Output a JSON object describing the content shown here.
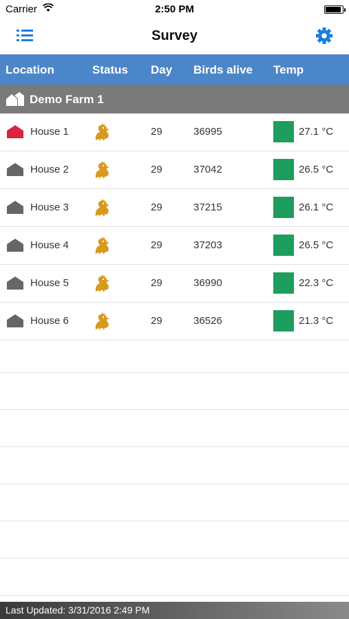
{
  "status_bar": {
    "carrier": "Carrier",
    "time": "2:50 PM",
    "battery_level": 0.9
  },
  "nav": {
    "title": "Survey",
    "menu_icon": "list-icon",
    "settings_icon": "gear-icon",
    "accent_color": "#1a7de0"
  },
  "columns": {
    "location": "Location",
    "status": "Status",
    "day": "Day",
    "birds_alive": "Birds alive",
    "temp": "Temp",
    "header_color": "#4b86c8"
  },
  "farm": {
    "name": "Demo Farm 1",
    "icon": "farm-icon"
  },
  "houses": [
    {
      "name": "House 1",
      "day": "29",
      "birds": "36995",
      "temp": "27.1 °C",
      "house_color": "#d7263d",
      "temp_color": "#1e9e5e",
      "status_icon": "chicken-icon"
    },
    {
      "name": "House 2",
      "day": "29",
      "birds": "37042",
      "temp": "26.5 °C",
      "house_color": "#666666",
      "temp_color": "#1e9e5e",
      "status_icon": "chicken-icon"
    },
    {
      "name": "House 3",
      "day": "29",
      "birds": "37215",
      "temp": "26.1 °C",
      "house_color": "#666666",
      "temp_color": "#1e9e5e",
      "status_icon": "chicken-icon"
    },
    {
      "name": "House 4",
      "day": "29",
      "birds": "37203",
      "temp": "26.5 °C",
      "house_color": "#666666",
      "temp_color": "#1e9e5e",
      "status_icon": "chicken-icon"
    },
    {
      "name": "House 5",
      "day": "29",
      "birds": "36990",
      "temp": "22.3 °C",
      "house_color": "#666666",
      "temp_color": "#1e9e5e",
      "status_icon": "chicken-icon"
    },
    {
      "name": "House 6",
      "day": "29",
      "birds": "36526",
      "temp": "21.3 °C",
      "house_color": "#666666",
      "temp_color": "#1e9e5e",
      "status_icon": "chicken-icon"
    }
  ],
  "footer": {
    "last_updated": "Last Updated: 3/31/2016 2:49 PM"
  }
}
